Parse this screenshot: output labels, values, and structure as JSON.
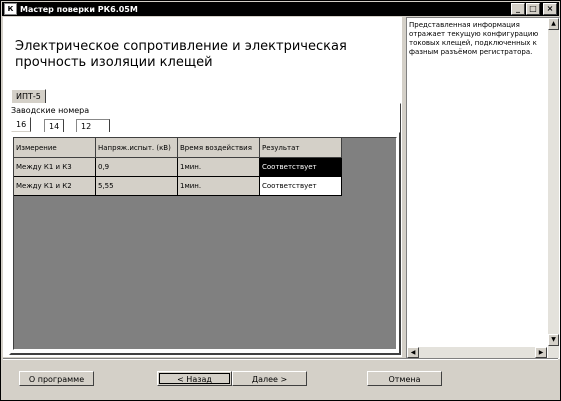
{
  "window": {
    "title": "Мастер поверки РК6.05М",
    "icon_glyph": "К",
    "controls": {
      "minimize": "_",
      "maximize": "□",
      "close": "×"
    }
  },
  "heading": {
    "line1": "Электрическое сопротивление и электрическая",
    "line2": "прочность изоляции клещей"
  },
  "outer_tabs": [
    {
      "label": "ИПТ-5",
      "active": true
    }
  ],
  "serials_label": "Заводские номера",
  "serial_tabs": [
    {
      "label": "16",
      "active": true
    },
    {
      "label": "14",
      "active": false
    },
    {
      "label": "12",
      "active": false
    }
  ],
  "table": {
    "columns": [
      "Измерение",
      "Напряж.испыт. (кВ)",
      "Время воздействия",
      "Результат"
    ],
    "rows": [
      {
        "measurement": "Между К1 и К3",
        "voltage": "0,9",
        "time": "1мин.",
        "result": "Соответствует",
        "selected": true
      },
      {
        "measurement": "Между К1 и К2",
        "voltage": "5,55",
        "time": "1мин.",
        "result": "Соответствует",
        "selected": false
      }
    ]
  },
  "info_panel": {
    "text": "Представленная информация отражает текущую конфигурацию токовых клещей, подключенных к фазным разъёмом регистратора."
  },
  "buttons": {
    "about": "О программе",
    "back": "< Назад",
    "next": "Далее >",
    "cancel": "Отмена"
  },
  "colors": {
    "title_bar": "#000000",
    "selection": "#000000",
    "face": "#d4d0c8"
  }
}
